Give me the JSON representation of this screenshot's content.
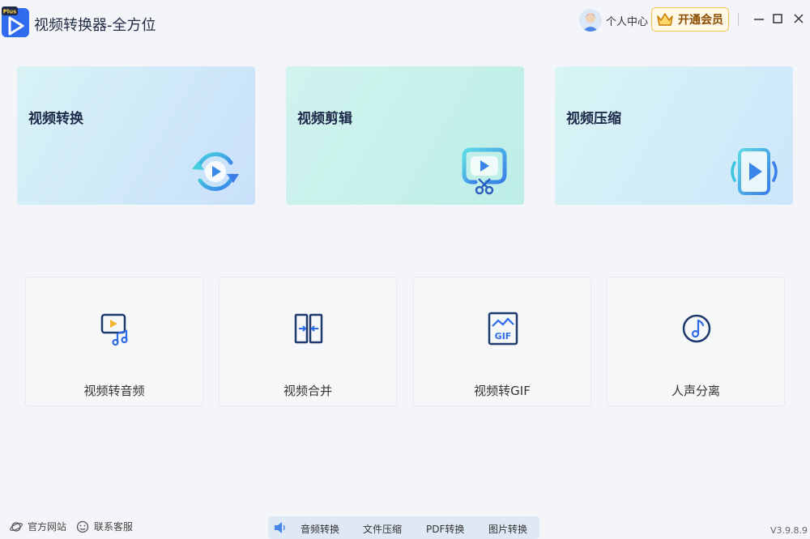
{
  "window": {
    "title": "视频转换器-全方位",
    "logo_badge": "Plus",
    "user_center_label": "个人中心",
    "vip_label": "开通会员",
    "accent": "#2f6bed"
  },
  "feature_cards": [
    {
      "label": "视频转换",
      "icon": "convert-cycle-icon"
    },
    {
      "label": "视频剪辑",
      "icon": "scissors-play-icon"
    },
    {
      "label": "视频压缩",
      "icon": "compress-play-icon"
    }
  ],
  "tool_cards": [
    {
      "label": "视频转音频",
      "icon": "video-to-audio-icon"
    },
    {
      "label": "视频合并",
      "icon": "merge-icon"
    },
    {
      "label": "视频转GIF",
      "icon": "gif-icon",
      "icon_text": "GIF"
    },
    {
      "label": "人声分离",
      "icon": "music-note-icon"
    }
  ],
  "footer": {
    "website_label": "官方网站",
    "support_label": "联系客服",
    "bar_items": [
      "音频转换",
      "文件压缩",
      "PDF转换",
      "图片转换"
    ],
    "version": "V3.9.8.9"
  }
}
